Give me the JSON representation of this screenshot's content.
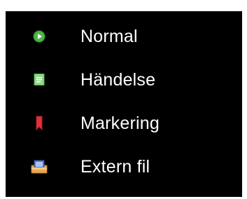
{
  "menu": {
    "items": [
      {
        "label": "Normal",
        "icon": "play-circle-icon",
        "color": "#3fa33a"
      },
      {
        "label": "Händelse",
        "icon": "note-icon",
        "color": "#7fcf75"
      },
      {
        "label": "Markering",
        "icon": "bookmark-icon",
        "color": "#e0303a"
      },
      {
        "label": "Extern fil",
        "icon": "film-folder-icon",
        "color": "#e8a850"
      }
    ]
  }
}
